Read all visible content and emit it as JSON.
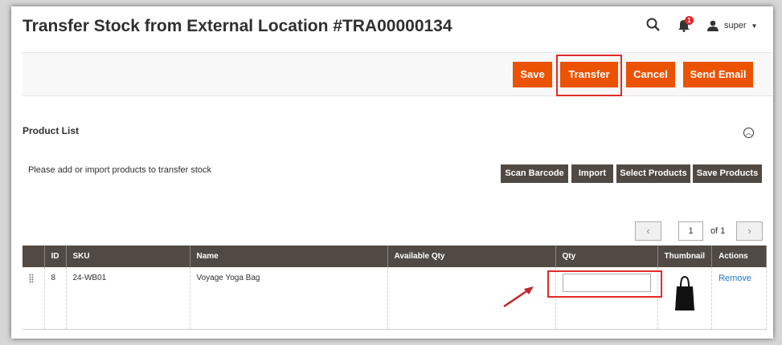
{
  "page": {
    "title": "Transfer Stock from External Location #TRA00000134",
    "user_name": "super",
    "notification_count": "1"
  },
  "actions": {
    "save": "Save",
    "transfer": "Transfer",
    "cancel": "Cancel",
    "send_email": "Send Email"
  },
  "product_list": {
    "title": "Product List",
    "hint": "Please add or import products to transfer stock",
    "buttons": {
      "scan_barcode": "Scan Barcode",
      "import": "Import",
      "select_products": "Select Products",
      "save_products": "Save Products"
    },
    "pager": {
      "current_page": "1",
      "of_label": "of 1"
    },
    "columns": [
      "ID",
      "SKU",
      "Name",
      "Available Qty",
      "Qty",
      "Thumbnail",
      "Actions"
    ],
    "rows": [
      {
        "id": "8",
        "sku": "24-WB01",
        "name": "Voyage Yoga Bag",
        "available_qty": "",
        "qty": "",
        "action": "Remove"
      }
    ]
  },
  "colors": {
    "accent": "#eb5202",
    "dark_button": "#514943",
    "highlight": "#e02b27",
    "link": "#1979c3"
  }
}
